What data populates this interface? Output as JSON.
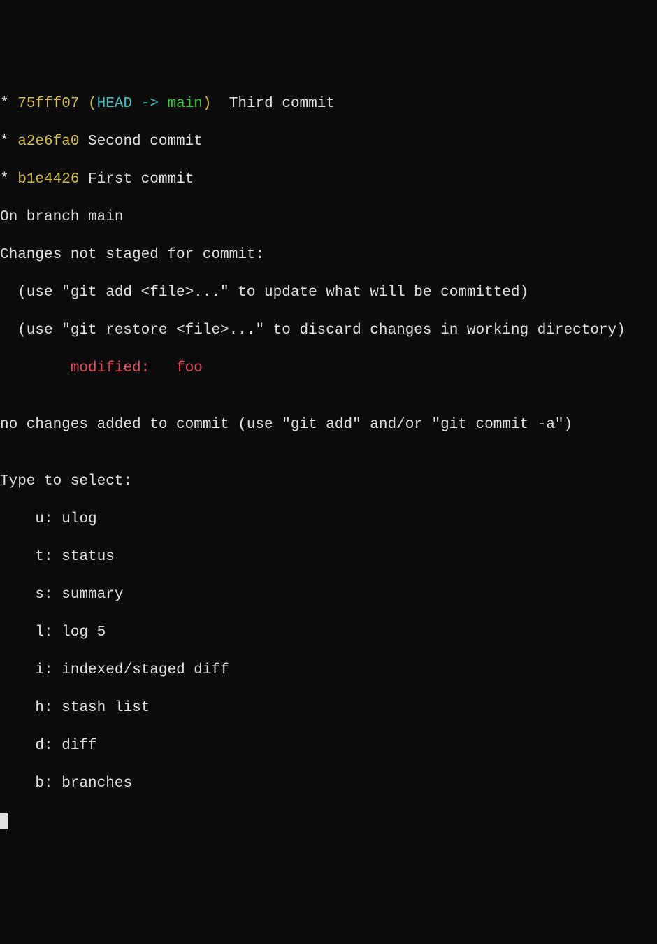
{
  "commits": [
    {
      "star": "*",
      "hash": "75fff07",
      "paren_open": "(",
      "head": "HEAD",
      "arrow": " -> ",
      "branch": "main",
      "paren_close": ")",
      "message": "  Third commit"
    },
    {
      "star": "*",
      "hash": "a2e6fa0",
      "message": " Second commit"
    },
    {
      "star": "*",
      "hash": "b1e4426",
      "message": " First commit"
    }
  ],
  "status": {
    "branch_line": "On branch main",
    "changes_header": "Changes not staged for commit:",
    "hint_add": "  (use \"git add <file>...\" to update what will be committed)",
    "hint_restore": "  (use \"git restore <file>...\" to discard changes in working directory)",
    "modified_indent": "        ",
    "modified_label": "modified:   ",
    "modified_file": "foo",
    "no_changes": "no changes added to commit (use \"git add\" and/or \"git commit -a\")"
  },
  "menu": {
    "header": "Type to select:",
    "items": [
      {
        "key": "u",
        "label": "ulog"
      },
      {
        "key": "t",
        "label": "status"
      },
      {
        "key": "s",
        "label": "summary"
      },
      {
        "key": "l",
        "label": "log 5"
      },
      {
        "key": "i",
        "label": "indexed/staged diff"
      },
      {
        "key": "h",
        "label": "stash list"
      },
      {
        "key": "d",
        "label": "diff"
      },
      {
        "key": "b",
        "label": "branches"
      }
    ]
  },
  "blank": ""
}
